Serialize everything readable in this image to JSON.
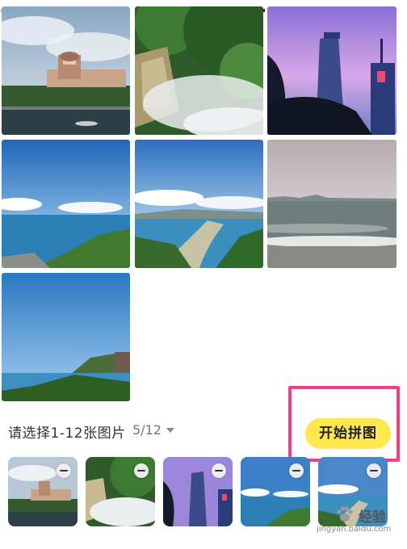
{
  "selection": {
    "prompt": "请选择1-12张图片",
    "count": "5/12",
    "start_button": "开始拼图"
  },
  "photos": [
    {
      "name": "hotel-building",
      "selected": true
    },
    {
      "name": "waterfall-mist",
      "selected": true
    },
    {
      "name": "tower-dusk",
      "selected": true
    },
    {
      "name": "sea-bay",
      "selected": true
    },
    {
      "name": "coast-city",
      "selected": true
    },
    {
      "name": "grey-beach",
      "selected": false
    },
    {
      "name": "sea-cliff",
      "selected": false
    }
  ],
  "icons": {
    "remove": "minus-circle-icon",
    "dropdown": "chevron-down-icon"
  },
  "watermark": {
    "brand": "经验",
    "url": "jingyan.baidu.com"
  },
  "colors": {
    "start_button_bg": "#ffe84d",
    "highlight_border": "#f03e87"
  }
}
